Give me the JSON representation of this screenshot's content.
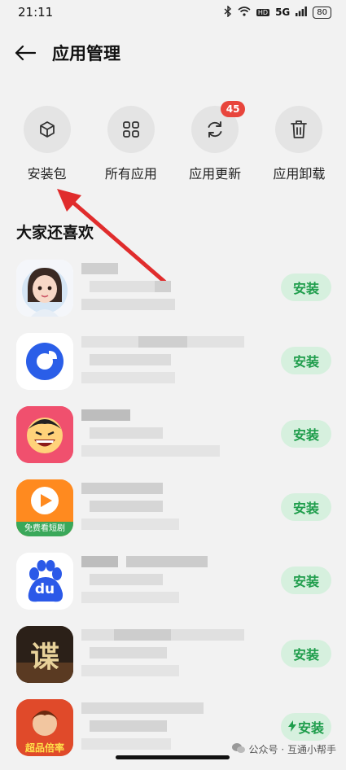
{
  "status": {
    "time": "21:11",
    "network": "5G",
    "hd": "HD",
    "battery": "80"
  },
  "header": {
    "title": "应用管理"
  },
  "actions": [
    {
      "label": "安装包",
      "icon": "package-icon"
    },
    {
      "label": "所有应用",
      "icon": "grid-icon"
    },
    {
      "label": "应用更新",
      "icon": "refresh-icon",
      "badge": "45"
    },
    {
      "label": "应用卸载",
      "icon": "trash-icon"
    }
  ],
  "section": {
    "title": "大家还喜欢"
  },
  "apps": [
    {
      "icon": "avatar-girl-icon",
      "button": "安装"
    },
    {
      "icon": "blue-circle-app-icon",
      "button": "安装"
    },
    {
      "icon": "laughing-face-app-icon",
      "button": "安装"
    },
    {
      "icon": "video-play-app-icon",
      "icon_text": "免费看短剧",
      "button": "安装"
    },
    {
      "icon": "baidu-paw-icon",
      "icon_text": "du",
      "button": "安装"
    },
    {
      "icon": "game-icon",
      "icon_text": "谍",
      "button": "安装"
    },
    {
      "icon": "game-hero-icon",
      "icon_text": "超品倍率",
      "button": "安装"
    }
  ],
  "watermark": "公众号 · 互通小帮手",
  "colors": {
    "badge": "#e8453c",
    "install_bg": "#d6f0de",
    "install_text": "#1f9d4c",
    "arrow": "#e02c2c"
  }
}
